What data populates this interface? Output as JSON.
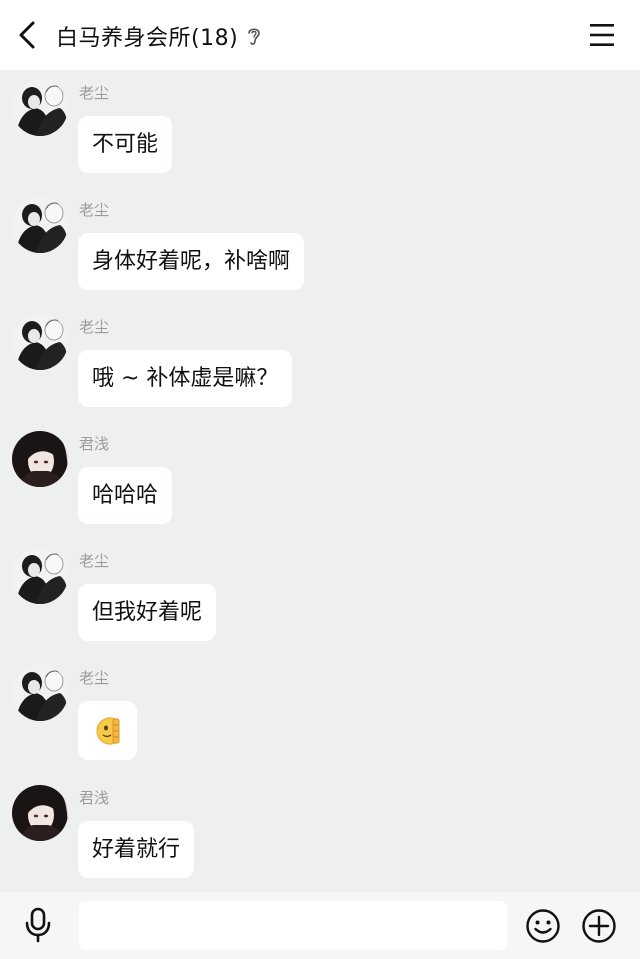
{
  "header": {
    "title": "白马养身会所(18)",
    "back_icon": "chevron-left-icon",
    "ear_icon": "ear-icon",
    "menu_icon": "hamburger-menu-icon"
  },
  "messages": [
    {
      "sender": "老尘",
      "text": "不可能",
      "avatar": "avatar-laochen"
    },
    {
      "sender": "老尘",
      "text": "身体好着呢，补啥啊",
      "avatar": "avatar-laochen"
    },
    {
      "sender": "老尘",
      "text": "哦 ~ 补体虚是嘛？",
      "avatar": "avatar-laochen"
    },
    {
      "sender": "君浅",
      "text": "哈哈哈",
      "avatar": "avatar-junqian"
    },
    {
      "sender": "老尘",
      "text": "但我好着呢",
      "avatar": "avatar-laochen"
    },
    {
      "sender": "老尘",
      "text": "",
      "emoji": "peeking-face-emoji",
      "avatar": "avatar-laochen"
    },
    {
      "sender": "君浅",
      "text": "好着就行",
      "avatar": "avatar-junqian"
    }
  ],
  "bottom_bar": {
    "mic_icon": "microphone-icon",
    "input_value": "",
    "emoji_icon": "smiley-icon",
    "plus_icon": "plus-circle-icon"
  },
  "colors": {
    "chat_background": "#eef0ed",
    "bubble": "#ffffff",
    "sender_name": "#9b9b9b"
  }
}
